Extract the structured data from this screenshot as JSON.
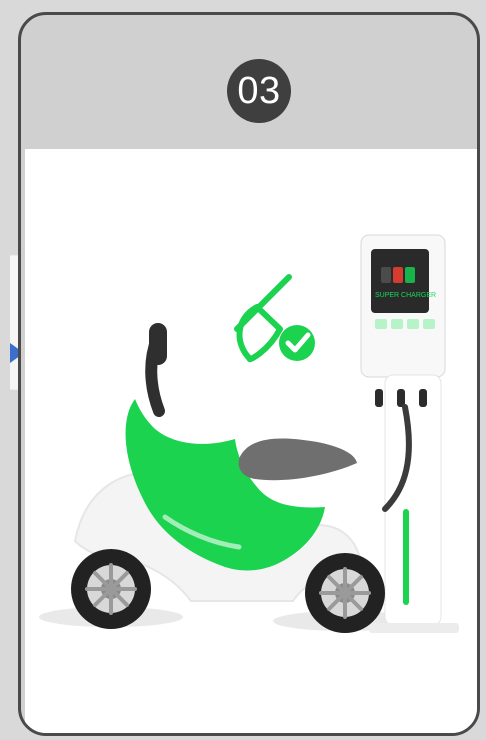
{
  "card": {
    "step_number": "03"
  },
  "charger": {
    "screen_title": "SUPER CHARGER"
  },
  "colors": {
    "green": "#1bd34f",
    "dark": "#2b2b2b",
    "gray": "#7a7a7a",
    "light_gray": "#e6e6e6",
    "arrow": "#2f67c8"
  },
  "icons": {
    "plug_check": "plug-check-icon",
    "arrow": "arrow-right-icon"
  }
}
